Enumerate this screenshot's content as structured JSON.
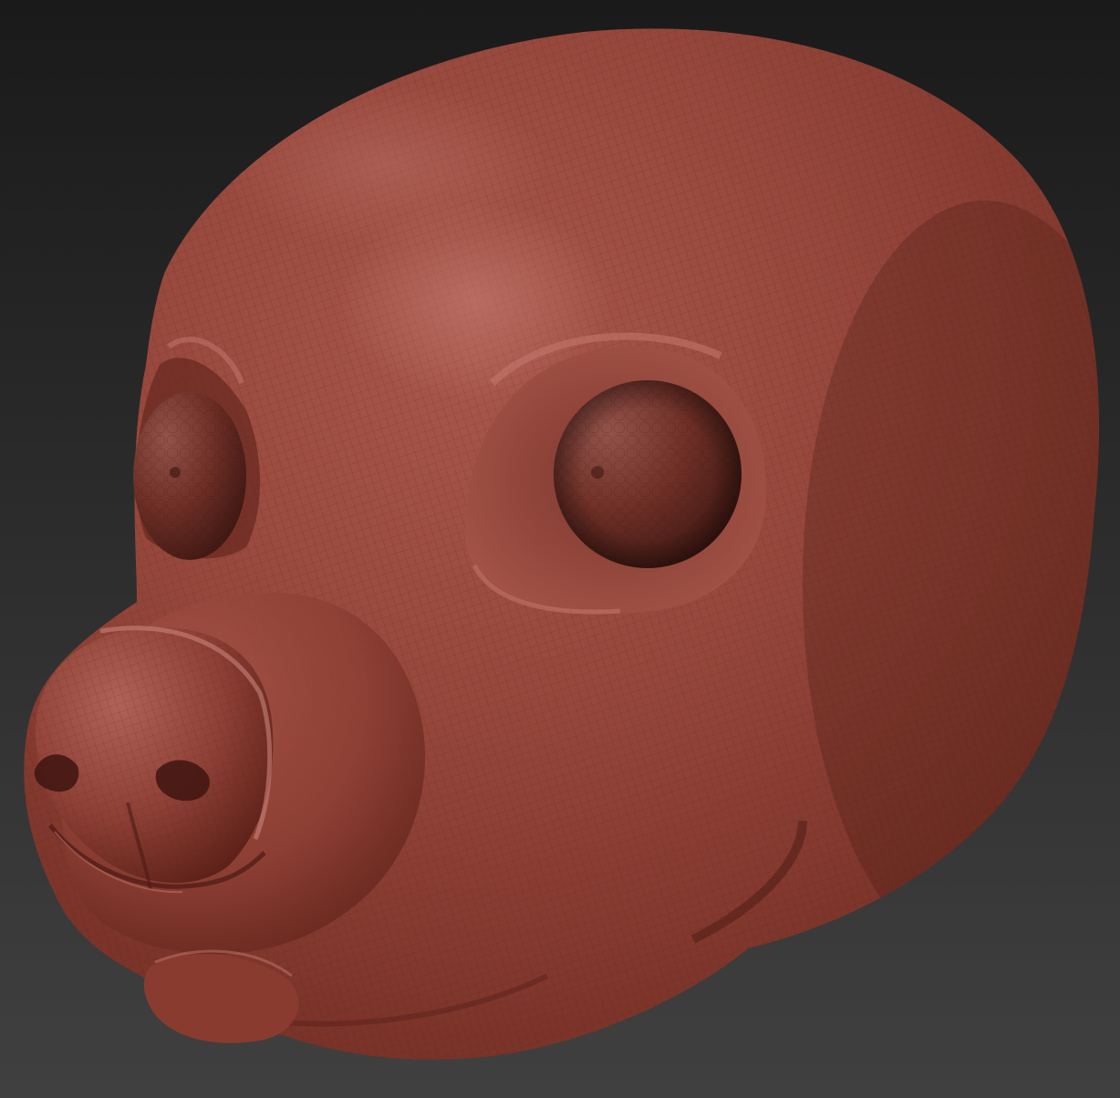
{
  "scene": {
    "subject": "sculpted-dog-head",
    "colors": {
      "background_top": "#1c1c1c",
      "background_bottom": "#3e3e3e",
      "clay_light": "#b8675c",
      "clay_mid": "#8a3e32",
      "clay_dark": "#4a1a14",
      "eye_light": "#8c4a40",
      "eye_dark": "#3d1712",
      "wireframe": "#5a2219"
    }
  }
}
